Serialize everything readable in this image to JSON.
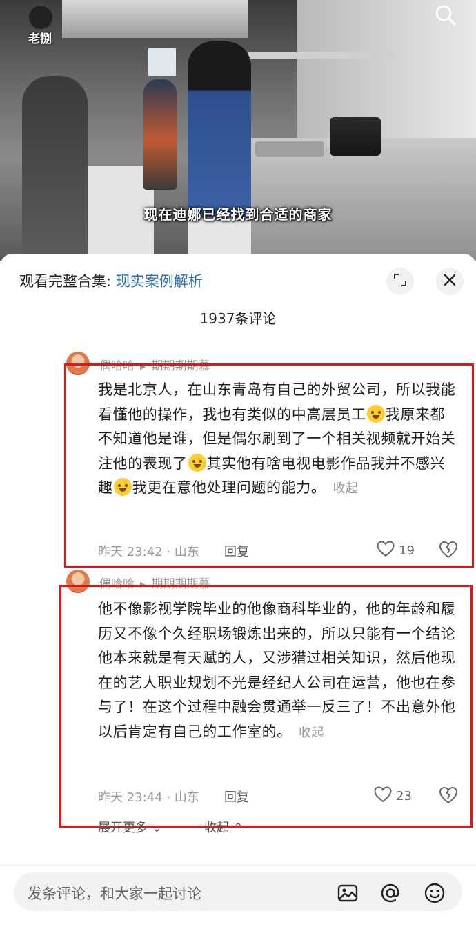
{
  "video": {
    "channel_logo_text": "老捌",
    "subtitle": "现在迪娜已经找到合适的商家"
  },
  "header": {
    "collection_prefix": "观看完整合集: ",
    "collection_link": "现实案例解析"
  },
  "comment_count": "1937条评论",
  "comments": [
    {
      "author": "偶哈哈",
      "reply_to": "期期期期慕",
      "text_part1": "我是北京人，在山东青岛有自己的外贸公司，所以我能看懂他的操作，我也有类似的中高层员工",
      "text_part2": "我原来都不知道他是谁，但是偶尔刷到了一个相关视频就开始关注他的表现了",
      "text_part3": "其实他有啥电视电影作品我并不感兴趣",
      "text_part4": "我更在意他处理问题的能力。",
      "fold_label": "收起",
      "time_location": "昨天 23:42 · 山东",
      "reply_label": "回复",
      "likes": "19"
    },
    {
      "author": "偶哈哈",
      "reply_to": "期期期期慕",
      "text": "他不像影视学院毕业的他像商科毕业的，他的年龄和履历又不像个久经职场锻炼出来的，所以只能有一个结论他本来就是有天赋的人，又涉猎过相关知识，然后他现在的艺人职业规划不光是经纪人公司在运营，他也在参与了！在这个过程中融会贯通举一反三了！不出意外他以后肯定有自己的工作室的。",
      "fold_label": "收起",
      "time_location": "昨天 23:44 · 山东",
      "reply_label": "回复",
      "likes": "23"
    }
  ],
  "expand_more": "展开更多",
  "collapse": "收起",
  "input": {
    "placeholder": "发条评论，和大家一起讨论"
  },
  "icons": {
    "search": "search-icon",
    "expand": "expand-icon",
    "close": "close-icon",
    "heart": "heart-icon",
    "dislike": "broken-heart-icon",
    "image": "image-icon",
    "mention": "at-icon",
    "emoji": "emoji-icon"
  },
  "colors": {
    "link": "#2a6fb0",
    "highlight_box": "#e01818"
  }
}
